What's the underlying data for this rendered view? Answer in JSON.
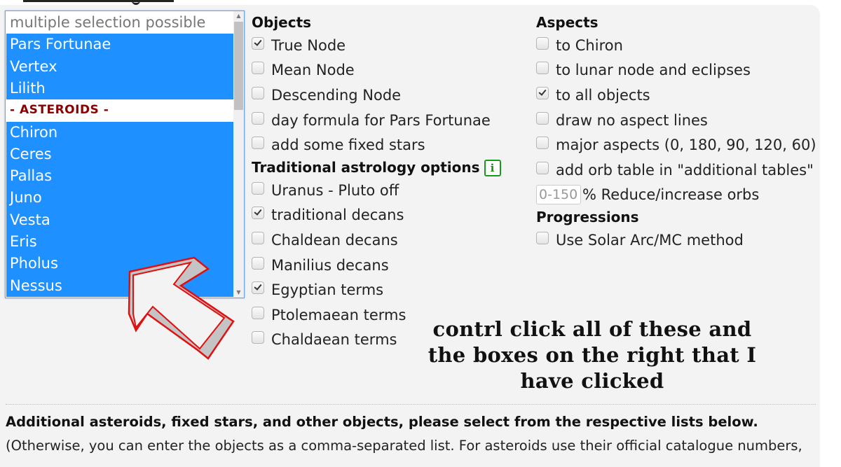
{
  "listbox": {
    "placeholder": "multiple selection possible",
    "options": [
      {
        "label": "Pars Fortunae",
        "selected": true
      },
      {
        "label": "Vertex",
        "selected": true
      },
      {
        "label": "Lilith",
        "selected": true
      }
    ],
    "group_label": "- ASTEROIDS -",
    "asteroids": [
      {
        "label": "Chiron",
        "selected": true
      },
      {
        "label": "Ceres",
        "selected": true
      },
      {
        "label": "Pallas",
        "selected": true
      },
      {
        "label": "Juno",
        "selected": true
      },
      {
        "label": "Vesta",
        "selected": true
      },
      {
        "label": "Eris",
        "selected": true
      },
      {
        "label": "Pholus",
        "selected": true
      },
      {
        "label": "Nessus",
        "selected": true
      }
    ]
  },
  "objects": {
    "heading": "Objects",
    "items": [
      {
        "label": "True Node",
        "checked": true
      },
      {
        "label": "Mean Node",
        "checked": false
      },
      {
        "label": "Descending Node",
        "checked": false
      },
      {
        "label": "day formula for Pars Fortunae",
        "checked": false
      },
      {
        "label": "add some fixed stars",
        "checked": false
      }
    ]
  },
  "traditional": {
    "heading": "Traditional astrology options",
    "info_icon": "i",
    "items": [
      {
        "label": "Uranus - Pluto off",
        "checked": false
      },
      {
        "label": "traditional decans",
        "checked": true
      },
      {
        "label": "Chaldean decans",
        "checked": false
      },
      {
        "label": "Manilius decans",
        "checked": false
      },
      {
        "label": "Egyptian terms",
        "checked": true
      },
      {
        "label": "Ptolemaean terms",
        "checked": false
      },
      {
        "label": "Chaldaean terms",
        "checked": false
      }
    ]
  },
  "aspects": {
    "heading": "Aspects",
    "items": [
      {
        "label": "to Chiron",
        "checked": false
      },
      {
        "label": "to lunar node and eclipses",
        "checked": false
      },
      {
        "label": "to all objects",
        "checked": true
      },
      {
        "label": "draw no aspect lines",
        "checked": false
      },
      {
        "label": "major aspects (0, 180, 90, 120, 60)",
        "checked": false
      },
      {
        "label": "add orb table in \"additional tables\"",
        "checked": false
      }
    ],
    "orb_input_placeholder": "0-150",
    "orb_input_value": "",
    "orb_label": "% Reduce/increase orbs"
  },
  "progressions": {
    "heading": "Progressions",
    "items": [
      {
        "label": "Use Solar Arc/MC method",
        "checked": false
      }
    ]
  },
  "annotation": {
    "lines": [
      "contrl click all of these and",
      "the boxes on the right that I",
      "have clicked"
    ]
  },
  "bottom": {
    "heading": "Additional asteroids, fixed stars, and other objects, please select from the respective lists below.",
    "note": "(Otherwise, you can enter the objects as a comma-separated list. For asteroids use their official catalogue numbers,"
  },
  "colors": {
    "selection": "#1e90ff",
    "group_label": "#8b0000",
    "info_icon": "#1a9a1a",
    "arrow_stroke": "#e01010",
    "arrow_fill": "#c4c4c4"
  }
}
